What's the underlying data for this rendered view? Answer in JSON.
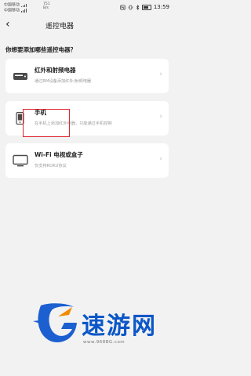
{
  "status_bar": {
    "carrier_1": "中国移动",
    "carrier_2": "中国移动",
    "net_speed_value": "751",
    "net_speed_unit": "B/s",
    "time": "13:59"
  },
  "header": {
    "title": "遥控电器"
  },
  "question": "你想要添加哪些遥控电器？",
  "options": [
    {
      "label": "红外和射频电器",
      "sub": "通过RM设备添加红外/射频电器",
      "icon": "ir-remote-device-icon"
    },
    {
      "label": "手机",
      "sub": "在手机上添加红外电器，只能通过手机控制",
      "icon": "phone-icon"
    },
    {
      "label": "Wi-Fi 电视或盒子",
      "sub": "仅支持ROKU协议",
      "icon": "tv-icon"
    }
  ],
  "watermark": {
    "text": "速游网",
    "url": "www.968BG.com",
    "color": "#0b57c8"
  },
  "colors": {
    "background": "#f2f2f2",
    "card": "#ffffff",
    "highlight": "#e0242e"
  }
}
